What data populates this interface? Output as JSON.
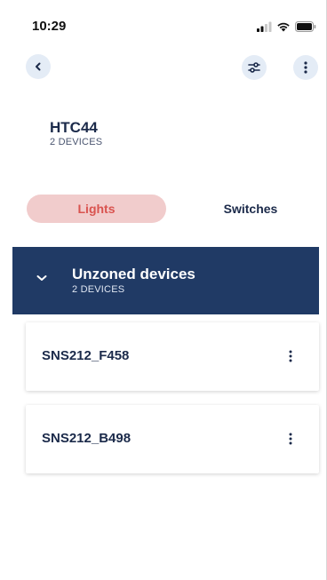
{
  "status_bar": {
    "time": "10:29",
    "icons": [
      "signal-icon",
      "wifi-icon",
      "battery-icon"
    ]
  },
  "nav": {
    "back_icon": "chevron-left-icon",
    "filter_icon": "sliders-icon",
    "more_icon": "vertical-ellipsis-icon"
  },
  "bridge": {
    "title": "HTC44",
    "subtitle": "2 DEVICES"
  },
  "tabs": [
    {
      "label": "Lights",
      "active": true
    },
    {
      "label": "Switches",
      "active": false
    }
  ],
  "zone": {
    "title": "Unzoned devices",
    "subtitle": "2 DEVICES",
    "expanded": true
  },
  "devices": [
    {
      "name": "SNS212_F458"
    },
    {
      "name": "SNS212_B498"
    }
  ],
  "colors": {
    "accent": "#d9534f",
    "tab_active_bg": "#f1cccc",
    "zone_bg": "#203a65",
    "text_primary": "#1b2a4a",
    "icon_button_bg": "#e4ecf6"
  }
}
